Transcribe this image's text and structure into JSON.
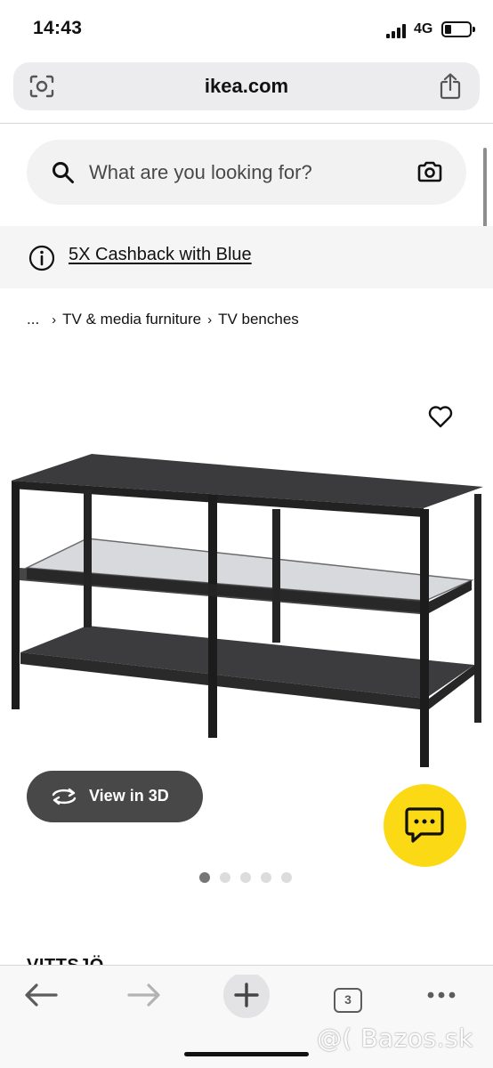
{
  "status_bar": {
    "time": "14:43",
    "network": "4G"
  },
  "browser": {
    "url": "ikea.com"
  },
  "search": {
    "placeholder": "What are you looking for?"
  },
  "promo": {
    "text": "5X Cashback with Blue"
  },
  "breadcrumb": {
    "items": [
      "...",
      "TV & media furniture",
      "TV benches"
    ]
  },
  "product": {
    "view_3d_label": "View in 3D",
    "name": "VITTSJÖ",
    "image_count": 5,
    "active_image": 0
  },
  "toolbar": {
    "tabs_count": "3"
  },
  "watermark": "@( Bazos.sk",
  "colors": {
    "chat_accent": "#fbd914",
    "view3d_bg": "#484848",
    "promo_bg": "#f5f5f5"
  },
  "icons": [
    "lens-icon",
    "share-icon",
    "search-icon",
    "camera-icon",
    "info-icon",
    "heart-icon",
    "rotate-3d-icon",
    "chat-icon",
    "back-arrow-icon",
    "forward-arrow-icon",
    "plus-icon",
    "tabs-icon",
    "more-icon"
  ]
}
